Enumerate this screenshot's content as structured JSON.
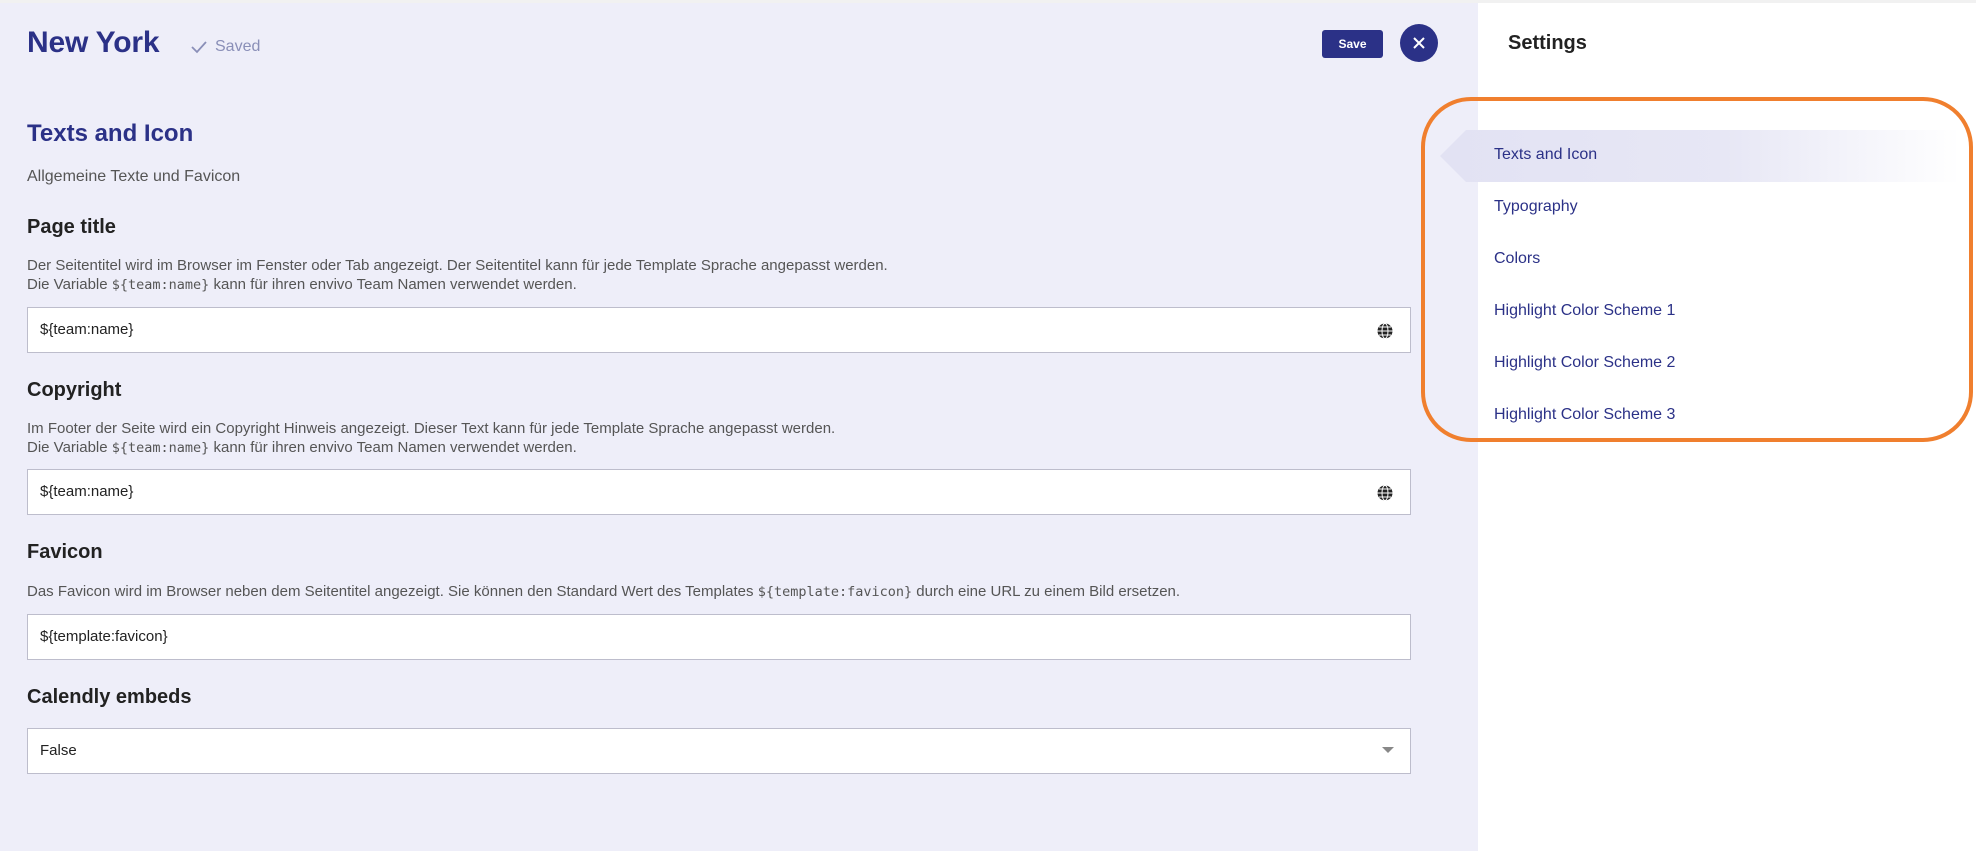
{
  "header": {
    "title": "New York",
    "saved_label": "Saved",
    "save_label": "Save",
    "check_icon": "check-icon",
    "close_icon": "close-icon"
  },
  "section": {
    "title": "Texts and Icon",
    "subtitle": "Allgemeine Texte und Favicon"
  },
  "fields": {
    "page_title": {
      "label": "Page title",
      "desc_line1": "Der Seitentitel wird im Browser im Fenster oder Tab angezeigt. Der Seitentitel kann für jede Template Sprache angepasst werden.",
      "desc_line2_before": "Die Variable",
      "desc_line2_code": "${team:name}",
      "desc_line2_after": "kann für ihren envivo Team Namen verwendet werden.",
      "value": "${team:name}",
      "icon": "globe-icon"
    },
    "copyright": {
      "label": "Copyright",
      "desc_line1": "Im Footer der Seite wird ein Copyright Hinweis angezeigt. Dieser Text kann für jede Template Sprache angepasst werden.",
      "desc_line2_before": "Die Variable",
      "desc_line2_code": "${team:name}",
      "desc_line2_after": "kann für ihren envivo Team Namen verwendet werden.",
      "value": "${team:name}",
      "icon": "globe-icon"
    },
    "favicon": {
      "label": "Favicon",
      "desc_before": "Das Favicon wird im Browser neben dem Seitentitel angezeigt. Sie können den Standard Wert des Templates",
      "desc_code": "${template:favicon}",
      "desc_after": "durch eine URL zu einem Bild ersetzen.",
      "value": "${template:favicon}"
    },
    "calendly": {
      "label": "Calendly embeds",
      "value": "False",
      "icon": "chevron-down-icon"
    }
  },
  "sidebar": {
    "title": "Settings",
    "items": [
      {
        "label": "Texts and Icon",
        "active": true
      },
      {
        "label": "Typography"
      },
      {
        "label": "Colors"
      },
      {
        "label": "Highlight Color Scheme 1"
      },
      {
        "label": "Highlight Color Scheme 2"
      },
      {
        "label": "Highlight Color Scheme 3"
      }
    ]
  },
  "colors": {
    "accent": "#2b3187",
    "main_background": "#eeeef9",
    "highlight_ring": "#f07f2e",
    "muted_text": "#555555"
  }
}
